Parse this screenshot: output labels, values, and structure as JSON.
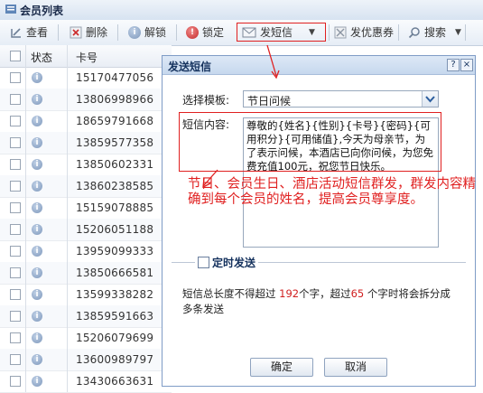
{
  "panel": {
    "title": "会员列表"
  },
  "toolbar": {
    "items": [
      {
        "label": "查看",
        "icon": "view-icon"
      },
      {
        "label": "删除",
        "icon": "delete-icon"
      },
      {
        "label": "解锁",
        "icon": "unlock-icon"
      },
      {
        "label": "锁定",
        "icon": "lock-icon"
      },
      {
        "label": "发短信",
        "icon": "sms-icon"
      },
      {
        "label": "发优惠券",
        "icon": "coupon-icon"
      },
      {
        "label": "搜索",
        "icon": "search-icon"
      }
    ]
  },
  "grid": {
    "columns": [
      "状态",
      "卡号"
    ],
    "rows": [
      "15170477056",
      "13806998966",
      "18659791668",
      "13859577358",
      "13850602331",
      "13860238585",
      "15159078885",
      "15206051188",
      "13959099333",
      "13850666581",
      "13599338282",
      "13859591663",
      "15206079699",
      "13600989797",
      "13430663631"
    ]
  },
  "dialog": {
    "title": "发送短信",
    "help": "?",
    "close": "×",
    "template_label": "选择模板:",
    "template_value": "节日问候",
    "content_label": "短信内容:",
    "content": "尊敬的{姓名}{性别}{卡号}{密码}{可用积分}{可用储值},今天为母亲节，为了表示问候，本酒店已向你问候，为您免费充值100元，祝您节日快乐。",
    "schedule_label": "定时发送",
    "note_prefix": "短信总长度不得超过 ",
    "note_max": "192",
    "note_mid": "个字，超过",
    "note_split": "65",
    "note_suffix": " 个字时将会拆分成多条发送",
    "ok_label": "确定",
    "cancel_label": "取消"
  },
  "annotation": {
    "text": "节日、会员生日、酒店活动短信群发，群发内容精确到每个会员的姓名，提高会员尊享度。"
  },
  "colors": {
    "highlight": "#e02020",
    "accent": "#15325e"
  }
}
